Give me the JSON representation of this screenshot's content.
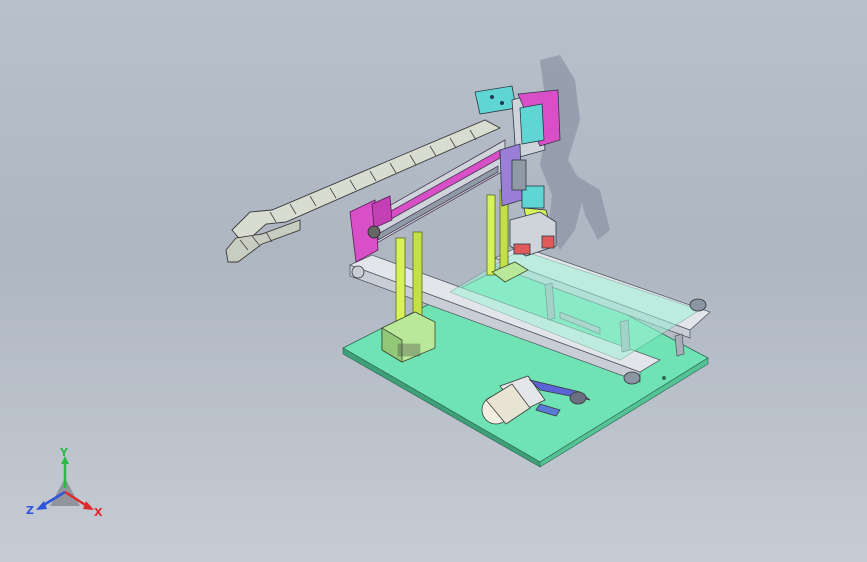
{
  "viewport": {
    "background_top": "#b8c0cb",
    "background_bottom": "#c6ccd4"
  },
  "model": {
    "base_plate_color": "#6fe3b4",
    "frame_color": "#b9c0c8",
    "column_color": "#d7f25a",
    "magenta_plate_color": "#d84fc8",
    "cyan_block_color": "#5fd6d4",
    "drag_chain_color": "#d9dcd0",
    "motor_color": "#f2efe2",
    "belt_color": "#9ff0d6"
  },
  "triad": {
    "y_label": "Y",
    "z_label": "Z",
    "x_label": "X",
    "y_color": "#2fb84a",
    "z_color": "#2f55d8",
    "x_color": "#e02a2a"
  }
}
